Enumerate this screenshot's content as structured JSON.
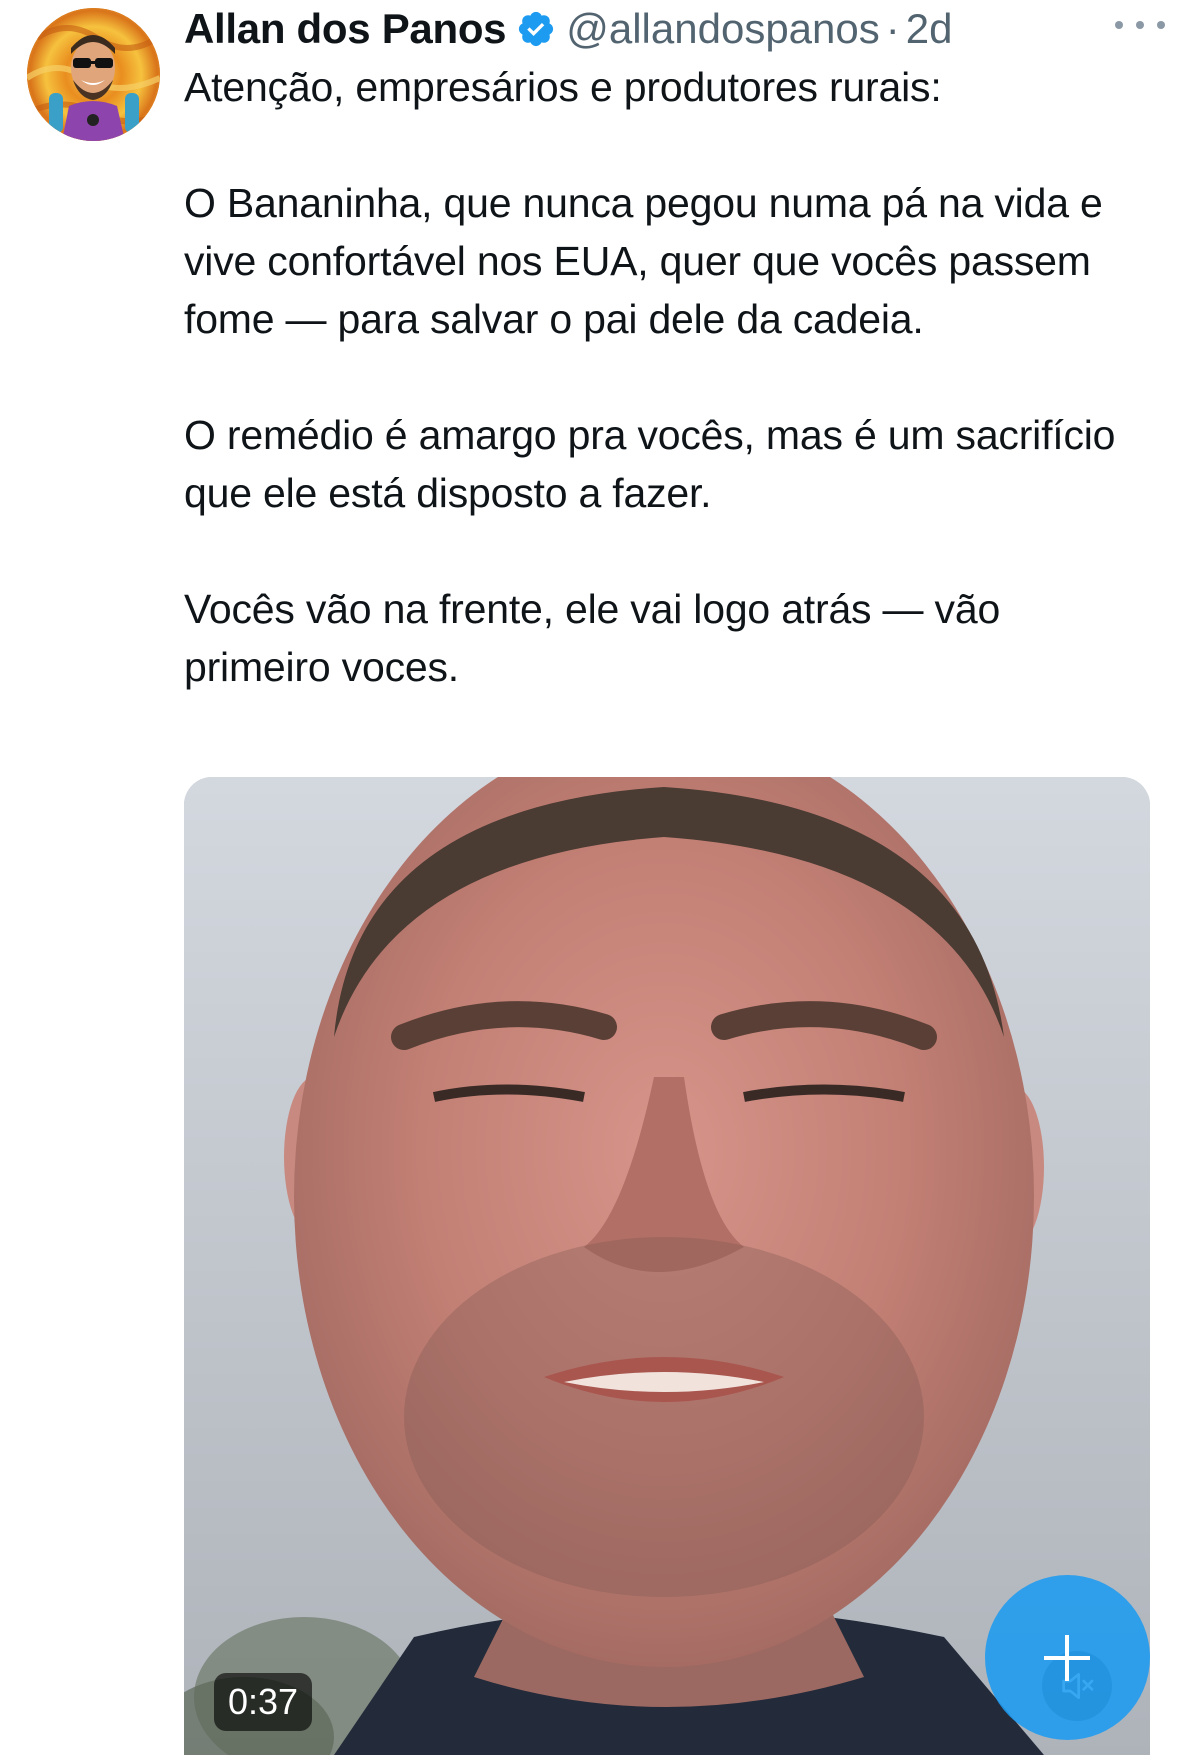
{
  "tweet": {
    "author": {
      "display_name": "Allan dos Panos",
      "handle": "@allandospanos",
      "verified_icon": "verified-badge-icon",
      "avatar_icon": "avatar-cartoon"
    },
    "separator": "·",
    "time": "2d",
    "more_icon": "more-horizontal-icon",
    "paragraphs": [
      "Atenção, empresários e produtores rurais:",
      "O Bananinha, que nunca pegou numa pá na vida e vive confortável nos EUA, quer que vocês passem fome — para salvar o pai dele da cadeia.",
      "O remédio é amargo pra vocês, mas é um sacrifício que ele está disposto a fazer.",
      "Vocês vão na frente, ele vai logo atrás — vão primeiro voces."
    ],
    "media": {
      "type": "video",
      "duration": "0:37",
      "mute_icon": "speaker-muted-icon"
    }
  },
  "compose_button": {
    "icon": "plus-icon"
  },
  "colors": {
    "text_primary": "#0f1419",
    "text_secondary": "#536471",
    "accent": "#1d9bf0",
    "verified": "#1d9bf0"
  }
}
